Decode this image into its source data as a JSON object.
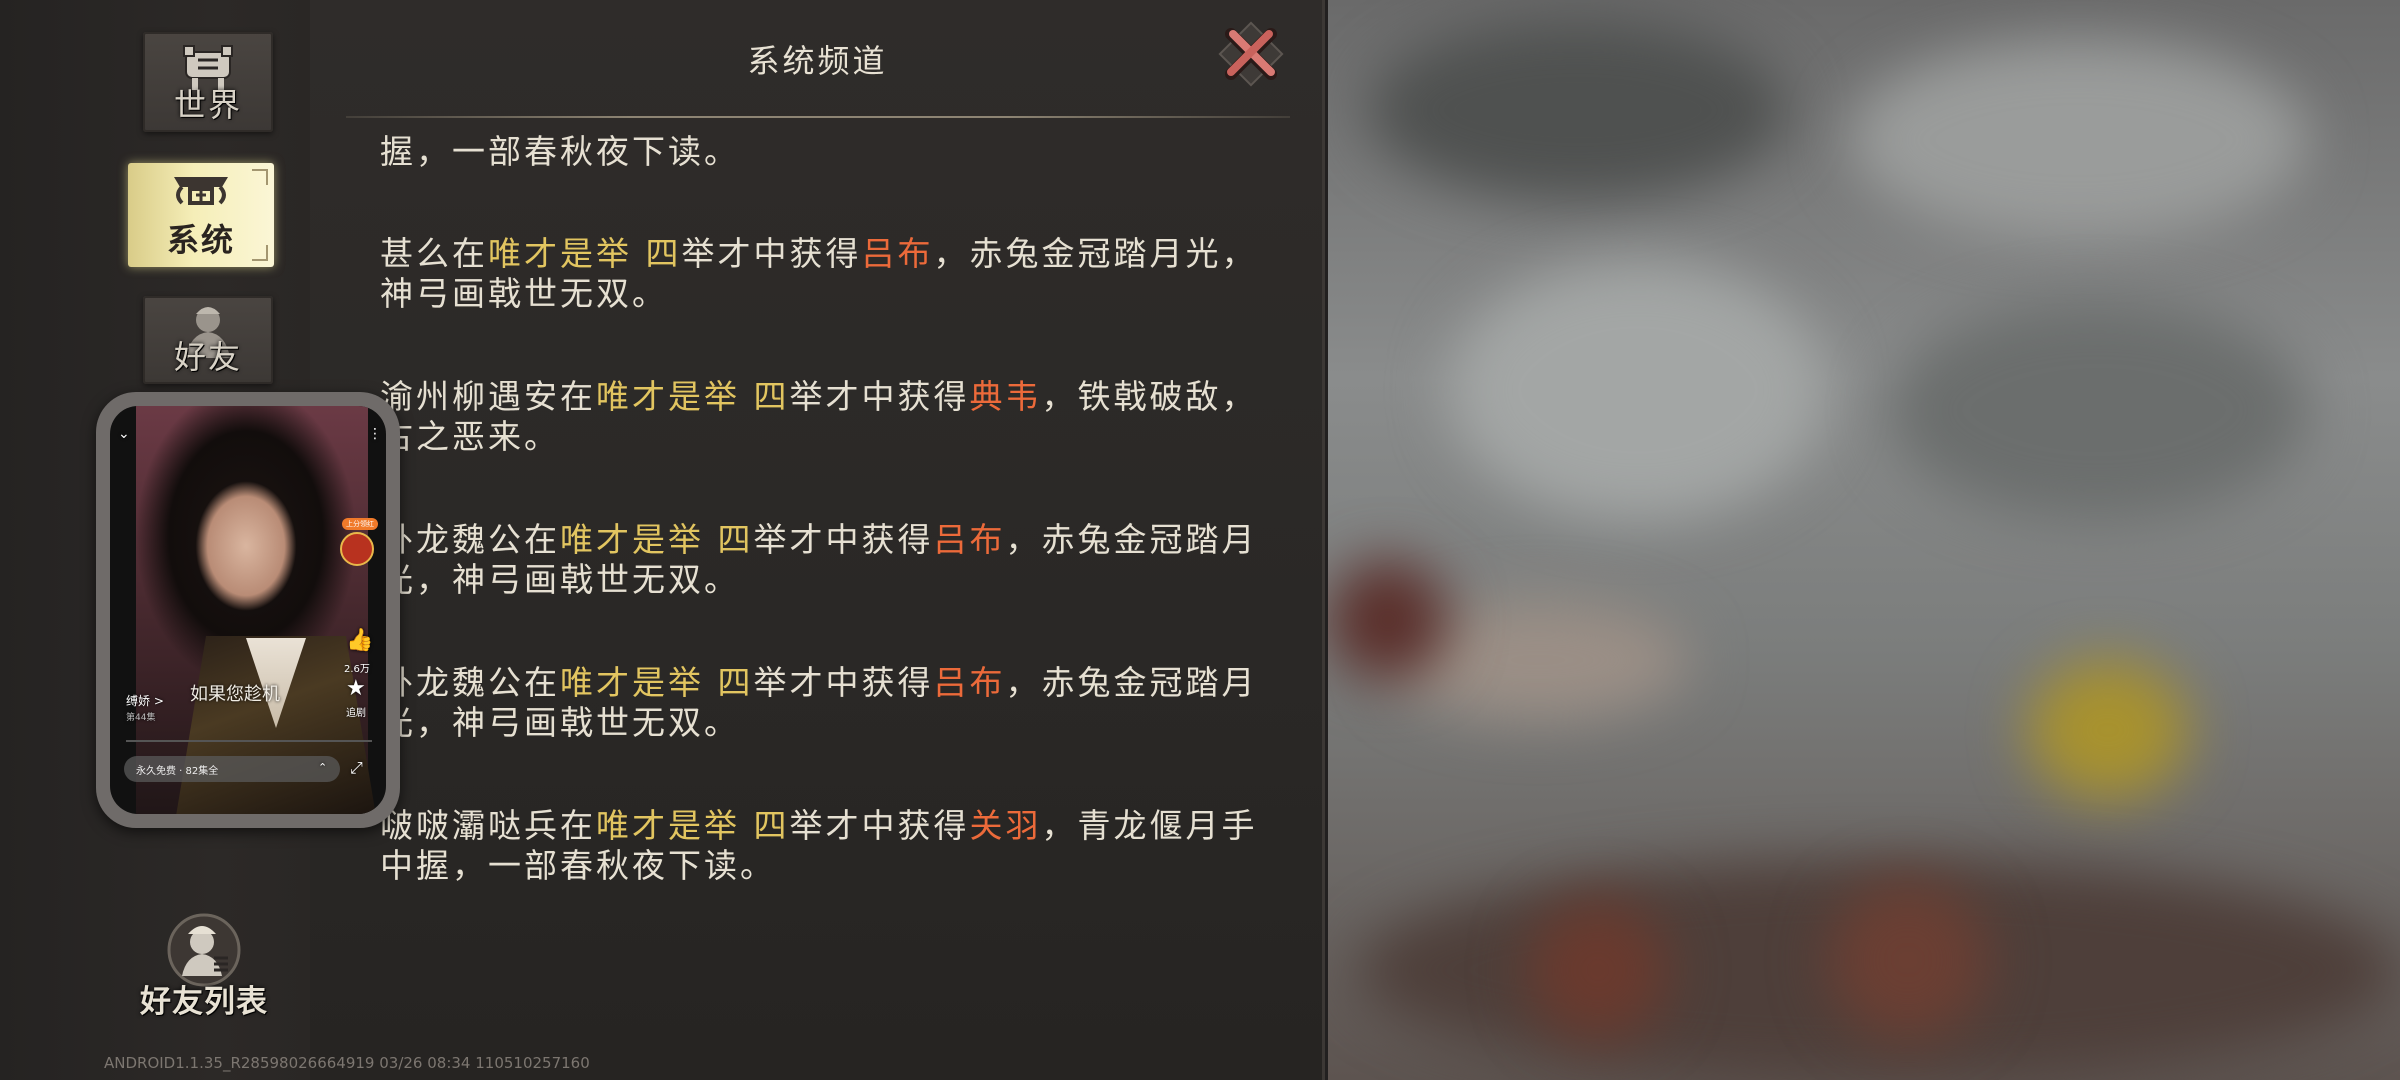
{
  "sidebar": {
    "tabs": [
      {
        "label": "世界",
        "icon": "cauldron-icon"
      },
      {
        "label": "系统",
        "icon": "scroll-emblem-icon"
      },
      {
        "label": "好友",
        "icon": "warrior-icon"
      }
    ],
    "friend_list_label": "好友列表"
  },
  "panel": {
    "title": "系统频道",
    "messages": [
      {
        "parts": [
          {
            "t": "握，一部春秋夜下读。",
            "c": ""
          }
        ]
      },
      {
        "parts": [
          {
            "t": "甚么在",
            "c": ""
          },
          {
            "t": "唯才是举 四",
            "c": "gold"
          },
          {
            "t": "举才中获得",
            "c": ""
          },
          {
            "t": "吕布",
            "c": "red"
          },
          {
            "t": "，赤兔金冠踏月光，神弓画戟世无双。",
            "c": ""
          }
        ]
      },
      {
        "parts": [
          {
            "t": "渝州柳遇安在",
            "c": ""
          },
          {
            "t": "唯才是举 四",
            "c": "gold"
          },
          {
            "t": "举才中获得",
            "c": ""
          },
          {
            "t": "典韦",
            "c": "red"
          },
          {
            "t": "，铁戟破敌，古之恶来。",
            "c": ""
          }
        ]
      },
      {
        "parts": [
          {
            "t": "卧龙魏公在",
            "c": ""
          },
          {
            "t": "唯才是举 四",
            "c": "gold"
          },
          {
            "t": "举才中获得",
            "c": ""
          },
          {
            "t": "吕布",
            "c": "red"
          },
          {
            "t": "，赤兔金冠踏月光，神弓画戟世无双。",
            "c": ""
          }
        ]
      },
      {
        "parts": [
          {
            "t": "卧龙魏公在",
            "c": ""
          },
          {
            "t": "唯才是举 四",
            "c": "gold"
          },
          {
            "t": "举才中获得",
            "c": ""
          },
          {
            "t": "吕布",
            "c": "red"
          },
          {
            "t": "，赤兔金冠踏月光，神弓画戟世无双。",
            "c": ""
          }
        ]
      },
      {
        "parts": [
          {
            "t": "啵啵灞哒兵在",
            "c": ""
          },
          {
            "t": "唯才是举 四",
            "c": "gold"
          },
          {
            "t": "举才中获得",
            "c": ""
          },
          {
            "t": "关羽",
            "c": "red"
          },
          {
            "t": "，青龙偃月手中握，一部春秋夜下读。",
            "c": ""
          }
        ]
      }
    ]
  },
  "video": {
    "subtitle": "如果您趁机",
    "author": "缚娇 >",
    "episode": "第44集",
    "like_count": "2.6万",
    "fav_label": "追剧",
    "badge": "上分领红",
    "pill_text": "永久免费 · 82集全"
  },
  "footer": {
    "version": "ANDROID1.1.35_R28598026664919 03/26 08:34 110510257160"
  },
  "colors": {
    "gold": "#e2c560",
    "red": "#ec6a3a",
    "text": "#e6e0d2",
    "active_tab": "#f5eeb8"
  }
}
